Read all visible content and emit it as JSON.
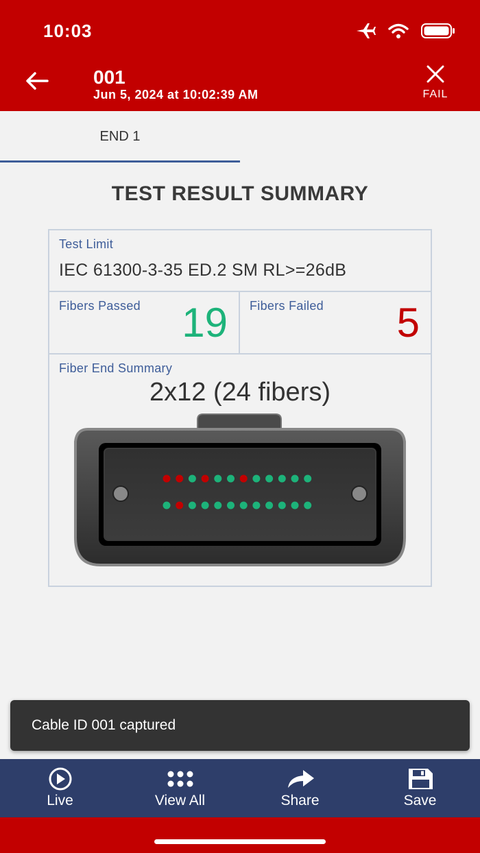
{
  "status_bar": {
    "time": "10:03",
    "icons": [
      "airplane-icon",
      "wifi-icon",
      "battery-icon"
    ]
  },
  "app_bar": {
    "title": "001",
    "subtitle": "Jun 5, 2024 at 10:02:39 AM",
    "result_label": "FAIL",
    "back_icon": "arrow-left-icon",
    "result_icon": "close-icon"
  },
  "tabs": [
    {
      "label": "END 1",
      "active": true
    }
  ],
  "summary": {
    "title": "TEST RESULT SUMMARY",
    "test_limit_label": "Test Limit",
    "test_limit_value": "IEC 61300-3-35 ED.2 SM RL>=26dB",
    "fibers_passed_label": "Fibers Passed",
    "fibers_passed": "19",
    "fibers_failed_label": "Fibers Failed",
    "fibers_failed": "5",
    "fiber_end_label": "Fiber End Summary",
    "fiber_config": "2x12 (24 fibers)",
    "fiber_rows": [
      [
        "fail",
        "fail",
        "pass",
        "fail",
        "pass",
        "pass",
        "fail",
        "pass",
        "pass",
        "pass",
        "pass",
        "pass"
      ],
      [
        "pass",
        "fail",
        "pass",
        "pass",
        "pass",
        "pass",
        "pass",
        "pass",
        "pass",
        "pass",
        "pass",
        "pass"
      ]
    ]
  },
  "toast": {
    "message": "Cable ID 001 captured"
  },
  "bottom_nav": [
    {
      "label": "Live",
      "icon": "play-circle-icon"
    },
    {
      "label": "View All",
      "icon": "grid-dots-icon"
    },
    {
      "label": "Share",
      "icon": "share-icon"
    },
    {
      "label": "Save",
      "icon": "save-icon"
    }
  ],
  "colors": {
    "brand_red": "#c20000",
    "nav_blue": "#2e3e6a",
    "label_blue": "#3e5d99",
    "pass_green": "#1db37a",
    "fail_red": "#c20000"
  }
}
